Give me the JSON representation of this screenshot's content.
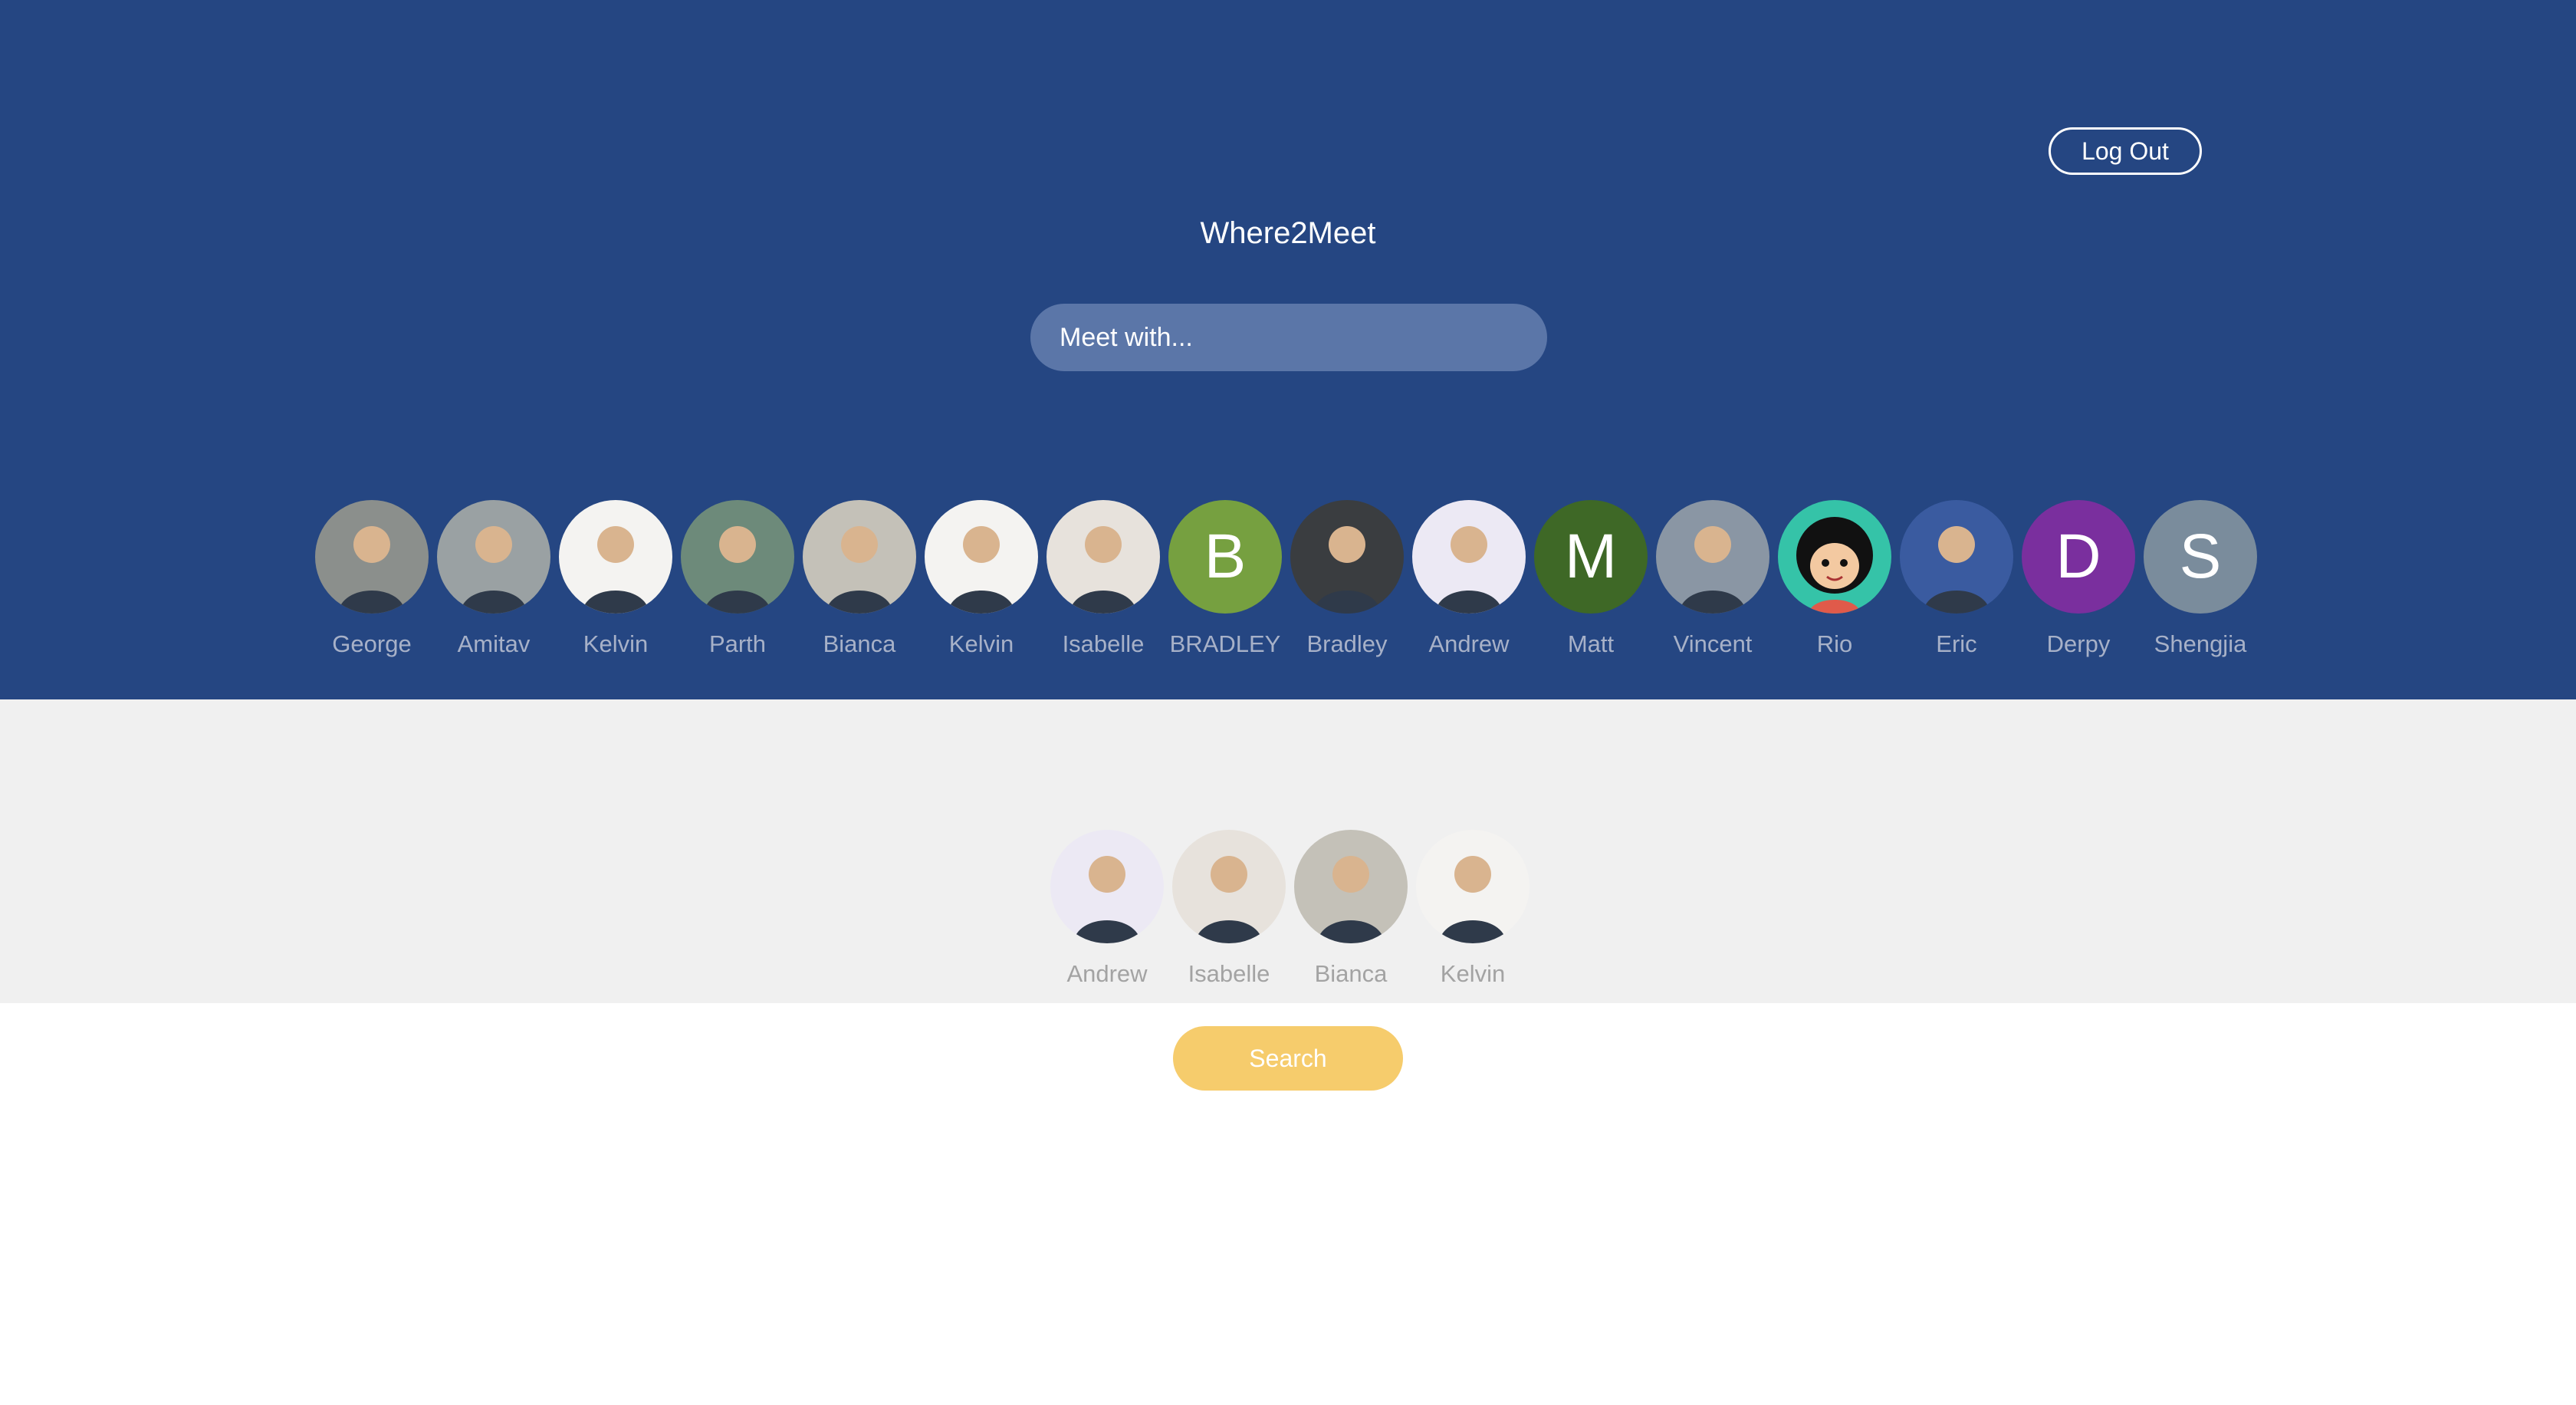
{
  "header": {
    "title": "Where2Meet",
    "logout_label": "Log Out",
    "search_placeholder": "Meet with..."
  },
  "friends": [
    {
      "name": "George",
      "avatar": "photo",
      "bg": "#8b8f8c"
    },
    {
      "name": "Amitav",
      "avatar": "photo",
      "bg": "#9aa1a3"
    },
    {
      "name": "Kelvin",
      "avatar": "photo",
      "bg": "#f4f3f1"
    },
    {
      "name": "Parth",
      "avatar": "photo",
      "bg": "#6d8a7a"
    },
    {
      "name": "Bianca",
      "avatar": "photo",
      "bg": "#c4c1b8"
    },
    {
      "name": "Kelvin",
      "avatar": "photo",
      "bg": "#f4f3f1"
    },
    {
      "name": "Isabelle",
      "avatar": "photo",
      "bg": "#e7e2dc"
    },
    {
      "name": "BRADLEY",
      "avatar": "letter",
      "letter": "B",
      "bg": "#76a040"
    },
    {
      "name": "Bradley",
      "avatar": "photo",
      "bg": "#3a3d40"
    },
    {
      "name": "Andrew",
      "avatar": "photo",
      "bg": "#ece9f4"
    },
    {
      "name": "Matt",
      "avatar": "letter",
      "letter": "M",
      "bg": "#3e6826"
    },
    {
      "name": "Vincent",
      "avatar": "photo",
      "bg": "#8a96a4"
    },
    {
      "name": "Rio",
      "avatar": "cartoon",
      "bg": "#35c3a8"
    },
    {
      "name": "Eric",
      "avatar": "photo",
      "bg": "#3a5ba0"
    },
    {
      "name": "Derpy",
      "avatar": "letter",
      "letter": "D",
      "bg": "#7a2f9e"
    },
    {
      "name": "Shengjia",
      "avatar": "letter",
      "letter": "S",
      "bg": "#7a8c9c"
    }
  ],
  "selected": [
    {
      "name": "Andrew",
      "bg": "#ece9f4"
    },
    {
      "name": "Isabelle",
      "bg": "#e7e2dc"
    },
    {
      "name": "Bianca",
      "bg": "#c4c1b8"
    },
    {
      "name": "Kelvin",
      "bg": "#f4f3f1"
    }
  ],
  "search_label": "Search",
  "colors": {
    "header_bg": "#254682",
    "search_bg": "#5b76a8",
    "selected_bg": "#f0f0f0",
    "search_button": "#f6cc6c"
  }
}
